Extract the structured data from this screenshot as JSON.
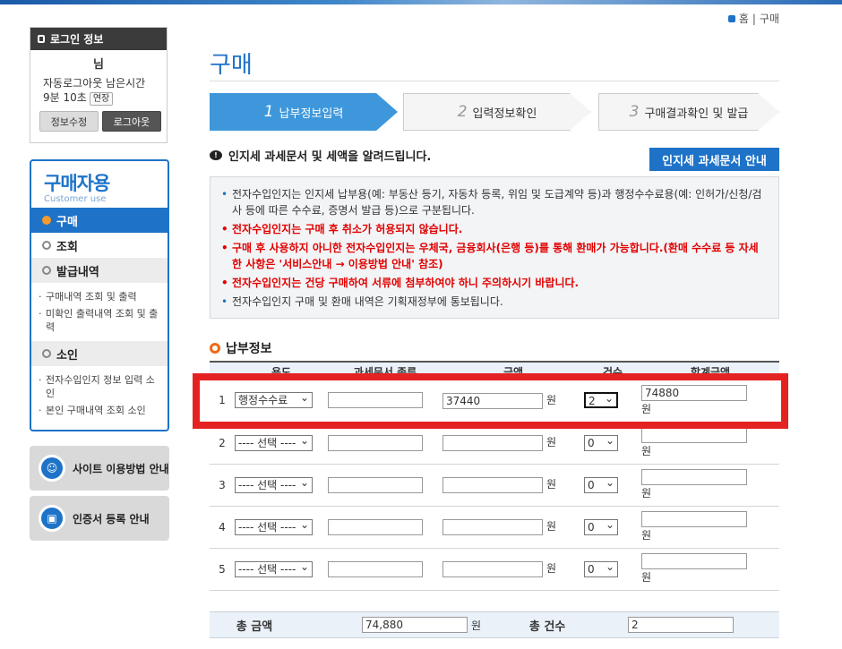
{
  "breadcrumb": {
    "home": "홈",
    "current": "구매"
  },
  "login": {
    "title": "로그인 정보",
    "name": "님",
    "auto_logout_line1": "자동로그아웃 남은시간",
    "auto_logout_line2": "9분 10초",
    "extend": "연장",
    "edit_button": "정보수정",
    "logout_button": "로그아웃"
  },
  "sidebar": {
    "title": "구매자용",
    "subtitle": "Customer use",
    "items": [
      {
        "label": "구매",
        "active": true
      },
      {
        "label": "조회"
      },
      {
        "label": "발급내역"
      }
    ],
    "issue_subitems": [
      "구매내역 조회 및 출력",
      "미확인 출력내역 조회 및 출력"
    ],
    "refund": "소인",
    "refund_subitems": [
      "전자수입인지 정보 입력 소인",
      "본인 구매내역 조회 소인"
    ]
  },
  "banners": [
    {
      "label": "사이트 이용방법 안내",
      "icon": "guide-icon"
    },
    {
      "label": "인증서 등록 안내",
      "icon": "lock-icon"
    }
  ],
  "page": {
    "title": "구매"
  },
  "steps": [
    {
      "num": "1",
      "label": "납부정보입력"
    },
    {
      "num": "2",
      "label": "입력정보확인"
    },
    {
      "num": "3",
      "label": "구매결과확인 및 발급"
    }
  ],
  "notice": {
    "heading": "인지세 과세문서 및 세액을 알려드립니다.",
    "guide_button": "인지세 과세문서 안내",
    "items": [
      "전자수입인지는 인지세 납부용(예: 부동산 등기, 자동차 등록, 위임 및 도급계약 등)과 행정수수료용(예: 인허가/신청/검사 등에 따른 수수료, 증명서 발급 등)으로 구분됩니다.",
      "전자수입인지는 구매 후 취소가 허용되지 않습니다.",
      "구매 후 사용하지 아니한 전자수입인지는 우체국, 금융회사(은행 등)를 통해 환매가 가능합니다.(환매 수수료 등 자세한 사항은 '서비스안내 → 이용방법 안내' 참조)",
      "전자수입인지는 건당 구매하여 서류에 첨부하여야 하니 주의하시기 바랍니다.",
      "전자수입인지 구매 및 환매 내역은 기획재정부에 통보됩니다."
    ]
  },
  "payment": {
    "section_title": "납부정보",
    "headers": [
      "용도",
      "과세문서 종류",
      "금액",
      "건수",
      "합계금액"
    ],
    "unit": "원",
    "rows": [
      {
        "no": "1",
        "purpose": "행정수수료",
        "doc": "",
        "amount": "37440",
        "count": "2",
        "total": "74880"
      },
      {
        "no": "2",
        "purpose": "---- 선택 ----",
        "doc": "",
        "amount": "",
        "count": "0",
        "total": ""
      },
      {
        "no": "3",
        "purpose": "---- 선택 ----",
        "doc": "",
        "amount": "",
        "count": "0",
        "total": ""
      },
      {
        "no": "4",
        "purpose": "---- 선택 ----",
        "doc": "",
        "amount": "",
        "count": "0",
        "total": ""
      },
      {
        "no": "5",
        "purpose": "---- 선택 ----",
        "doc": "",
        "amount": "",
        "count": "0",
        "total": ""
      }
    ],
    "total_amount_label": "총 금액",
    "total_amount": "74,880",
    "total_count_label": "총 건수",
    "total_count": "2"
  }
}
